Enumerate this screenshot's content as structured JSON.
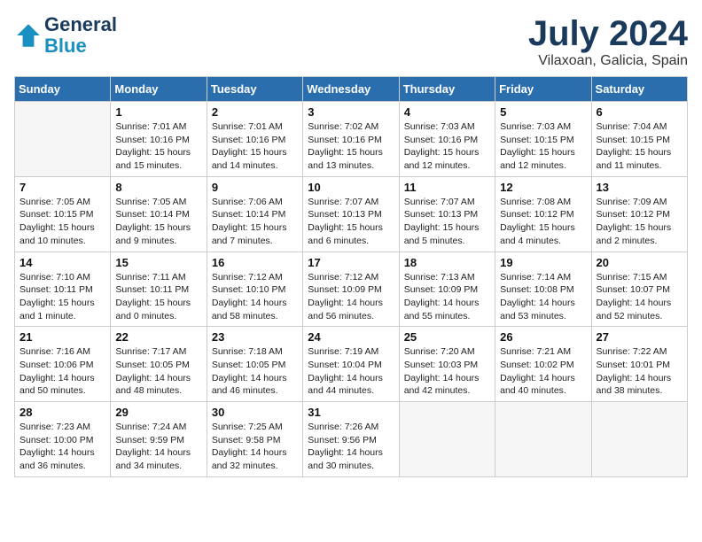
{
  "header": {
    "logo_line1": "General",
    "logo_line2": "Blue",
    "month_title": "July 2024",
    "location": "Vilaxoan, Galicia, Spain"
  },
  "weekdays": [
    "Sunday",
    "Monday",
    "Tuesday",
    "Wednesday",
    "Thursday",
    "Friday",
    "Saturday"
  ],
  "weeks": [
    [
      {
        "day": "",
        "info": ""
      },
      {
        "day": "1",
        "info": "Sunrise: 7:01 AM\nSunset: 10:16 PM\nDaylight: 15 hours\nand 15 minutes."
      },
      {
        "day": "2",
        "info": "Sunrise: 7:01 AM\nSunset: 10:16 PM\nDaylight: 15 hours\nand 14 minutes."
      },
      {
        "day": "3",
        "info": "Sunrise: 7:02 AM\nSunset: 10:16 PM\nDaylight: 15 hours\nand 13 minutes."
      },
      {
        "day": "4",
        "info": "Sunrise: 7:03 AM\nSunset: 10:16 PM\nDaylight: 15 hours\nand 12 minutes."
      },
      {
        "day": "5",
        "info": "Sunrise: 7:03 AM\nSunset: 10:15 PM\nDaylight: 15 hours\nand 12 minutes."
      },
      {
        "day": "6",
        "info": "Sunrise: 7:04 AM\nSunset: 10:15 PM\nDaylight: 15 hours\nand 11 minutes."
      }
    ],
    [
      {
        "day": "7",
        "info": "Sunrise: 7:05 AM\nSunset: 10:15 PM\nDaylight: 15 hours\nand 10 minutes."
      },
      {
        "day": "8",
        "info": "Sunrise: 7:05 AM\nSunset: 10:14 PM\nDaylight: 15 hours\nand 9 minutes."
      },
      {
        "day": "9",
        "info": "Sunrise: 7:06 AM\nSunset: 10:14 PM\nDaylight: 15 hours\nand 7 minutes."
      },
      {
        "day": "10",
        "info": "Sunrise: 7:07 AM\nSunset: 10:13 PM\nDaylight: 15 hours\nand 6 minutes."
      },
      {
        "day": "11",
        "info": "Sunrise: 7:07 AM\nSunset: 10:13 PM\nDaylight: 15 hours\nand 5 minutes."
      },
      {
        "day": "12",
        "info": "Sunrise: 7:08 AM\nSunset: 10:12 PM\nDaylight: 15 hours\nand 4 minutes."
      },
      {
        "day": "13",
        "info": "Sunrise: 7:09 AM\nSunset: 10:12 PM\nDaylight: 15 hours\nand 2 minutes."
      }
    ],
    [
      {
        "day": "14",
        "info": "Sunrise: 7:10 AM\nSunset: 10:11 PM\nDaylight: 15 hours\nand 1 minute."
      },
      {
        "day": "15",
        "info": "Sunrise: 7:11 AM\nSunset: 10:11 PM\nDaylight: 15 hours\nand 0 minutes."
      },
      {
        "day": "16",
        "info": "Sunrise: 7:12 AM\nSunset: 10:10 PM\nDaylight: 14 hours\nand 58 minutes."
      },
      {
        "day": "17",
        "info": "Sunrise: 7:12 AM\nSunset: 10:09 PM\nDaylight: 14 hours\nand 56 minutes."
      },
      {
        "day": "18",
        "info": "Sunrise: 7:13 AM\nSunset: 10:09 PM\nDaylight: 14 hours\nand 55 minutes."
      },
      {
        "day": "19",
        "info": "Sunrise: 7:14 AM\nSunset: 10:08 PM\nDaylight: 14 hours\nand 53 minutes."
      },
      {
        "day": "20",
        "info": "Sunrise: 7:15 AM\nSunset: 10:07 PM\nDaylight: 14 hours\nand 52 minutes."
      }
    ],
    [
      {
        "day": "21",
        "info": "Sunrise: 7:16 AM\nSunset: 10:06 PM\nDaylight: 14 hours\nand 50 minutes."
      },
      {
        "day": "22",
        "info": "Sunrise: 7:17 AM\nSunset: 10:05 PM\nDaylight: 14 hours\nand 48 minutes."
      },
      {
        "day": "23",
        "info": "Sunrise: 7:18 AM\nSunset: 10:05 PM\nDaylight: 14 hours\nand 46 minutes."
      },
      {
        "day": "24",
        "info": "Sunrise: 7:19 AM\nSunset: 10:04 PM\nDaylight: 14 hours\nand 44 minutes."
      },
      {
        "day": "25",
        "info": "Sunrise: 7:20 AM\nSunset: 10:03 PM\nDaylight: 14 hours\nand 42 minutes."
      },
      {
        "day": "26",
        "info": "Sunrise: 7:21 AM\nSunset: 10:02 PM\nDaylight: 14 hours\nand 40 minutes."
      },
      {
        "day": "27",
        "info": "Sunrise: 7:22 AM\nSunset: 10:01 PM\nDaylight: 14 hours\nand 38 minutes."
      }
    ],
    [
      {
        "day": "28",
        "info": "Sunrise: 7:23 AM\nSunset: 10:00 PM\nDaylight: 14 hours\nand 36 minutes."
      },
      {
        "day": "29",
        "info": "Sunrise: 7:24 AM\nSunset: 9:59 PM\nDaylight: 14 hours\nand 34 minutes."
      },
      {
        "day": "30",
        "info": "Sunrise: 7:25 AM\nSunset: 9:58 PM\nDaylight: 14 hours\nand 32 minutes."
      },
      {
        "day": "31",
        "info": "Sunrise: 7:26 AM\nSunset: 9:56 PM\nDaylight: 14 hours\nand 30 minutes."
      },
      {
        "day": "",
        "info": ""
      },
      {
        "day": "",
        "info": ""
      },
      {
        "day": "",
        "info": ""
      }
    ]
  ]
}
